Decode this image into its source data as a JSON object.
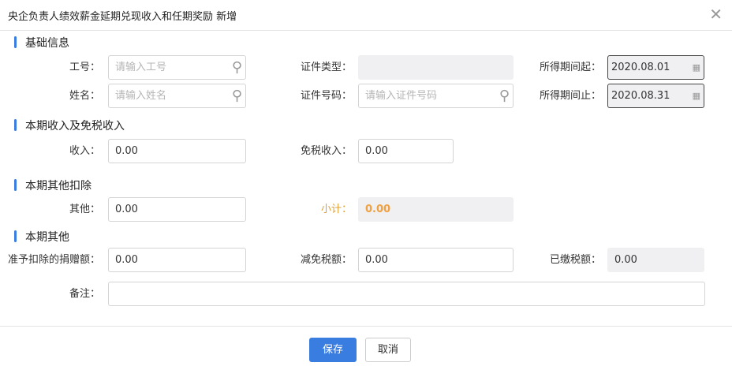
{
  "dialog": {
    "title": "央企负责人绩效薪金延期兑现收入和任期奖励 新增"
  },
  "sections": {
    "basic": "基础信息",
    "income": "本期收入及免税收入",
    "deduction": "本期其他扣除",
    "other": "本期其他"
  },
  "fields": {
    "employee_id": {
      "label": "工号：",
      "placeholder": "请输入工号"
    },
    "name": {
      "label": "姓名：",
      "placeholder": "请输入姓名"
    },
    "id_type": {
      "label": "证件类型：",
      "value": ""
    },
    "id_number": {
      "label": "证件号码：",
      "placeholder": "请输入证件号码"
    },
    "period_start": {
      "label": "所得期间起：",
      "value": "2020.08.01"
    },
    "period_end": {
      "label": "所得期间止：",
      "value": "2020.08.31"
    },
    "income": {
      "label": "收入：",
      "value": "0.00"
    },
    "tax_free_income": {
      "label": "免税收入：",
      "value": "0.00"
    },
    "other": {
      "label": "其他：",
      "value": "0.00"
    },
    "subtotal": {
      "label": "小计：",
      "value": "0.00"
    },
    "donation": {
      "label": "准予扣除的捐赠额：",
      "value": "0.00"
    },
    "tax_reduction": {
      "label": "减免税额：",
      "value": "0.00"
    },
    "tax_paid": {
      "label": "已缴税额：",
      "value": "0.00"
    },
    "remark": {
      "label": "备注：",
      "value": ""
    }
  },
  "footer": {
    "save": "保存",
    "cancel": "取消"
  },
  "colors": {
    "accent": "#3a7de0",
    "subtotal": "#f0a040"
  }
}
